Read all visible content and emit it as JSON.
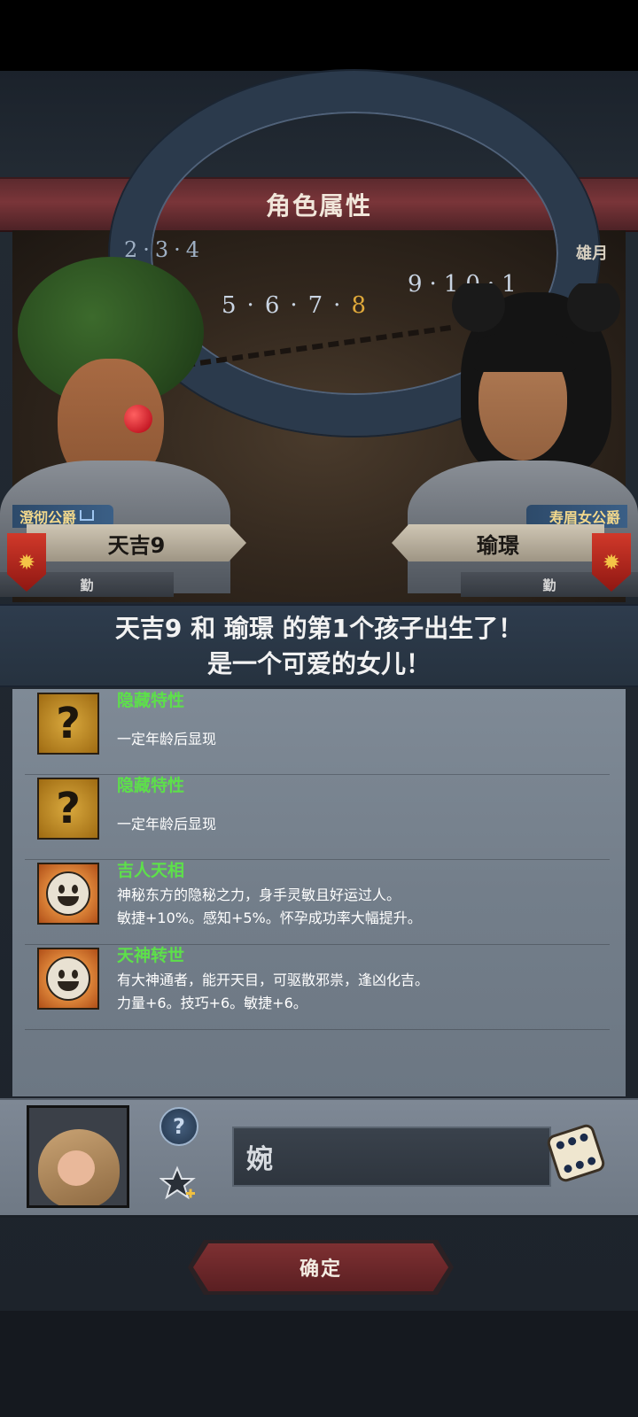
{
  "header": {
    "title": "角色属性"
  },
  "scene": {
    "corner_label": "雄月",
    "dial_left": "2·3·4",
    "dial_numbers": [
      "5",
      "6",
      "7"
    ],
    "dial_highlight": "8",
    "dial_right": "9·10·1"
  },
  "father": {
    "title": "澄彻公爵",
    "name": "天吉9",
    "trait": "勤"
  },
  "mother": {
    "title": "寿眉女公爵",
    "name": "瑜璟",
    "trait": "勤"
  },
  "announcement": {
    "line1": "天吉9 和 瑜璟 的第1个孩子出生了！",
    "line2": "是一个可爱的女儿！"
  },
  "traits": [
    {
      "name": "隐藏特性",
      "desc1": "一定年龄后显现",
      "desc2": "",
      "icon": "question-mark-icon"
    },
    {
      "name": "隐藏特性",
      "desc1": "一定年龄后显现",
      "desc2": "",
      "icon": "question-mark-icon"
    },
    {
      "name": "吉人天相",
      "desc1": "神秘东方的隐秘之力，身手灵敏且好运过人。",
      "desc2": "敏捷+10%。感知+5%。怀孕成功率大幅提升。",
      "icon": "smiley-icon"
    },
    {
      "name": "天神转世",
      "desc1": "有大神通者，能开天目，可驱散邪祟，逢凶化吉。",
      "desc2": "力量+6。技巧+6。敏捷+6。",
      "icon": "smiley-icon"
    }
  ],
  "child": {
    "name_value": "婉",
    "help_glyph": "?"
  },
  "confirm_label": "确定",
  "colors": {
    "title_bar": "#7a3539",
    "trait_name": "#5de04a",
    "confirm_button": "#7e3032"
  }
}
